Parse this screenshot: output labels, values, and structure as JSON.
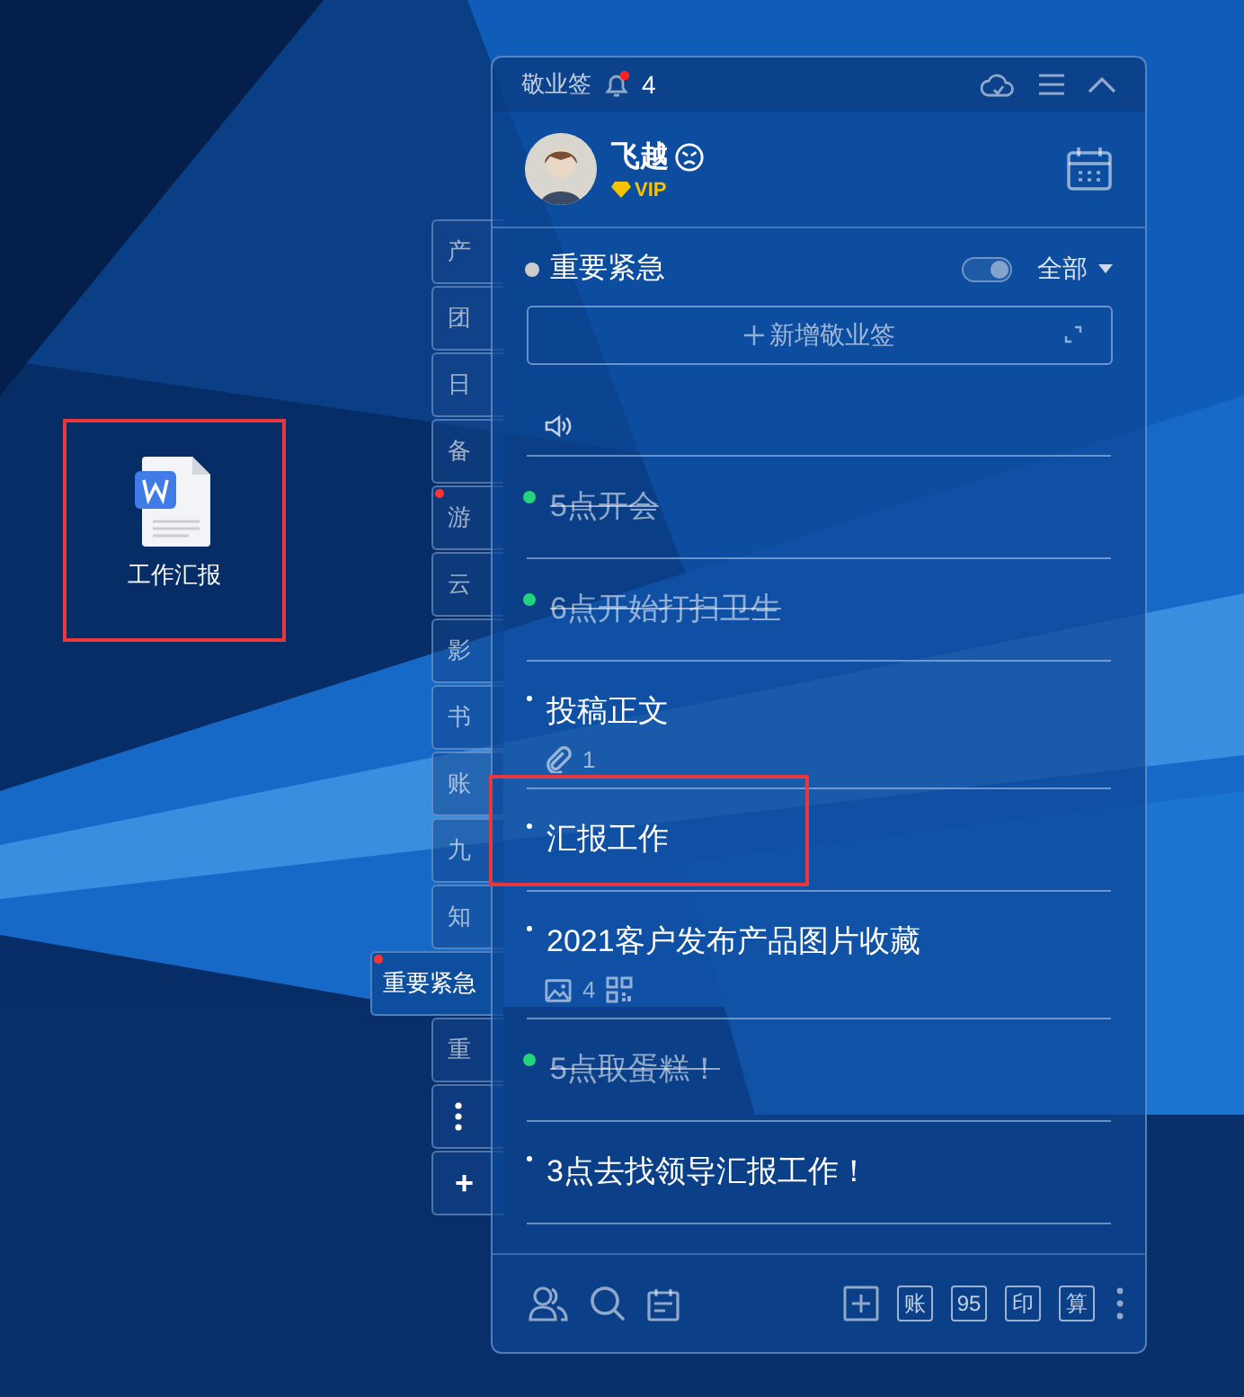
{
  "desktop_icon": {
    "label": "工作汇报",
    "highlighted": true
  },
  "side_tabs": [
    {
      "kind": "text",
      "label": "产",
      "selected": false,
      "unread": false
    },
    {
      "kind": "text",
      "label": "团",
      "selected": false,
      "unread": false
    },
    {
      "kind": "text",
      "label": "日",
      "selected": false,
      "unread": false
    },
    {
      "kind": "text",
      "label": "备",
      "selected": false,
      "unread": false
    },
    {
      "kind": "text",
      "label": "游",
      "selected": false,
      "unread": true
    },
    {
      "kind": "text",
      "label": "云",
      "selected": false,
      "unread": false
    },
    {
      "kind": "text",
      "label": "影",
      "selected": false,
      "unread": false
    },
    {
      "kind": "text",
      "label": "书",
      "selected": false,
      "unread": false
    },
    {
      "kind": "text",
      "label": "账",
      "selected": false,
      "unread": false
    },
    {
      "kind": "text",
      "label": "九",
      "selected": false,
      "unread": false
    },
    {
      "kind": "text",
      "label": "知",
      "selected": false,
      "unread": false
    },
    {
      "kind": "text",
      "label": "重要紧急",
      "selected": true,
      "unread": true
    },
    {
      "kind": "text",
      "label": "重",
      "selected": false,
      "unread": false
    },
    {
      "kind": "more",
      "selected": false,
      "unread": false
    },
    {
      "kind": "add",
      "label": "+",
      "selected": false,
      "unread": false
    }
  ],
  "panel": {
    "title": "敬业签",
    "notifications": "4",
    "unread": true,
    "user": {
      "name": "飞越",
      "badge": "VIP"
    },
    "category": {
      "name": "重要紧急",
      "toggle_on": true,
      "filter": "全部"
    },
    "add_button": "新增敬业签",
    "partial_item": {
      "audio": true
    },
    "notes": [
      {
        "text": "5点开会",
        "done": true,
        "highlighted": false
      },
      {
        "text": "6点开始打扫卫生",
        "done": true,
        "highlighted": false
      },
      {
        "text": "投稿正文",
        "done": false,
        "highlighted": false,
        "meta": {
          "kind": "attachment",
          "count": "1"
        }
      },
      {
        "text": "汇报工作",
        "done": false,
        "highlighted": true
      },
      {
        "text": "2021客户发布产品图片收藏",
        "done": false,
        "highlighted": false,
        "meta": {
          "kind": "images",
          "count": "4"
        }
      },
      {
        "text": "5点取蛋糕！",
        "done": true,
        "highlighted": false
      },
      {
        "text": "3点去找领导汇报工作！",
        "done": false,
        "highlighted": false
      }
    ],
    "toolbar_keys": [
      "账",
      "95",
      "印",
      "算"
    ]
  }
}
